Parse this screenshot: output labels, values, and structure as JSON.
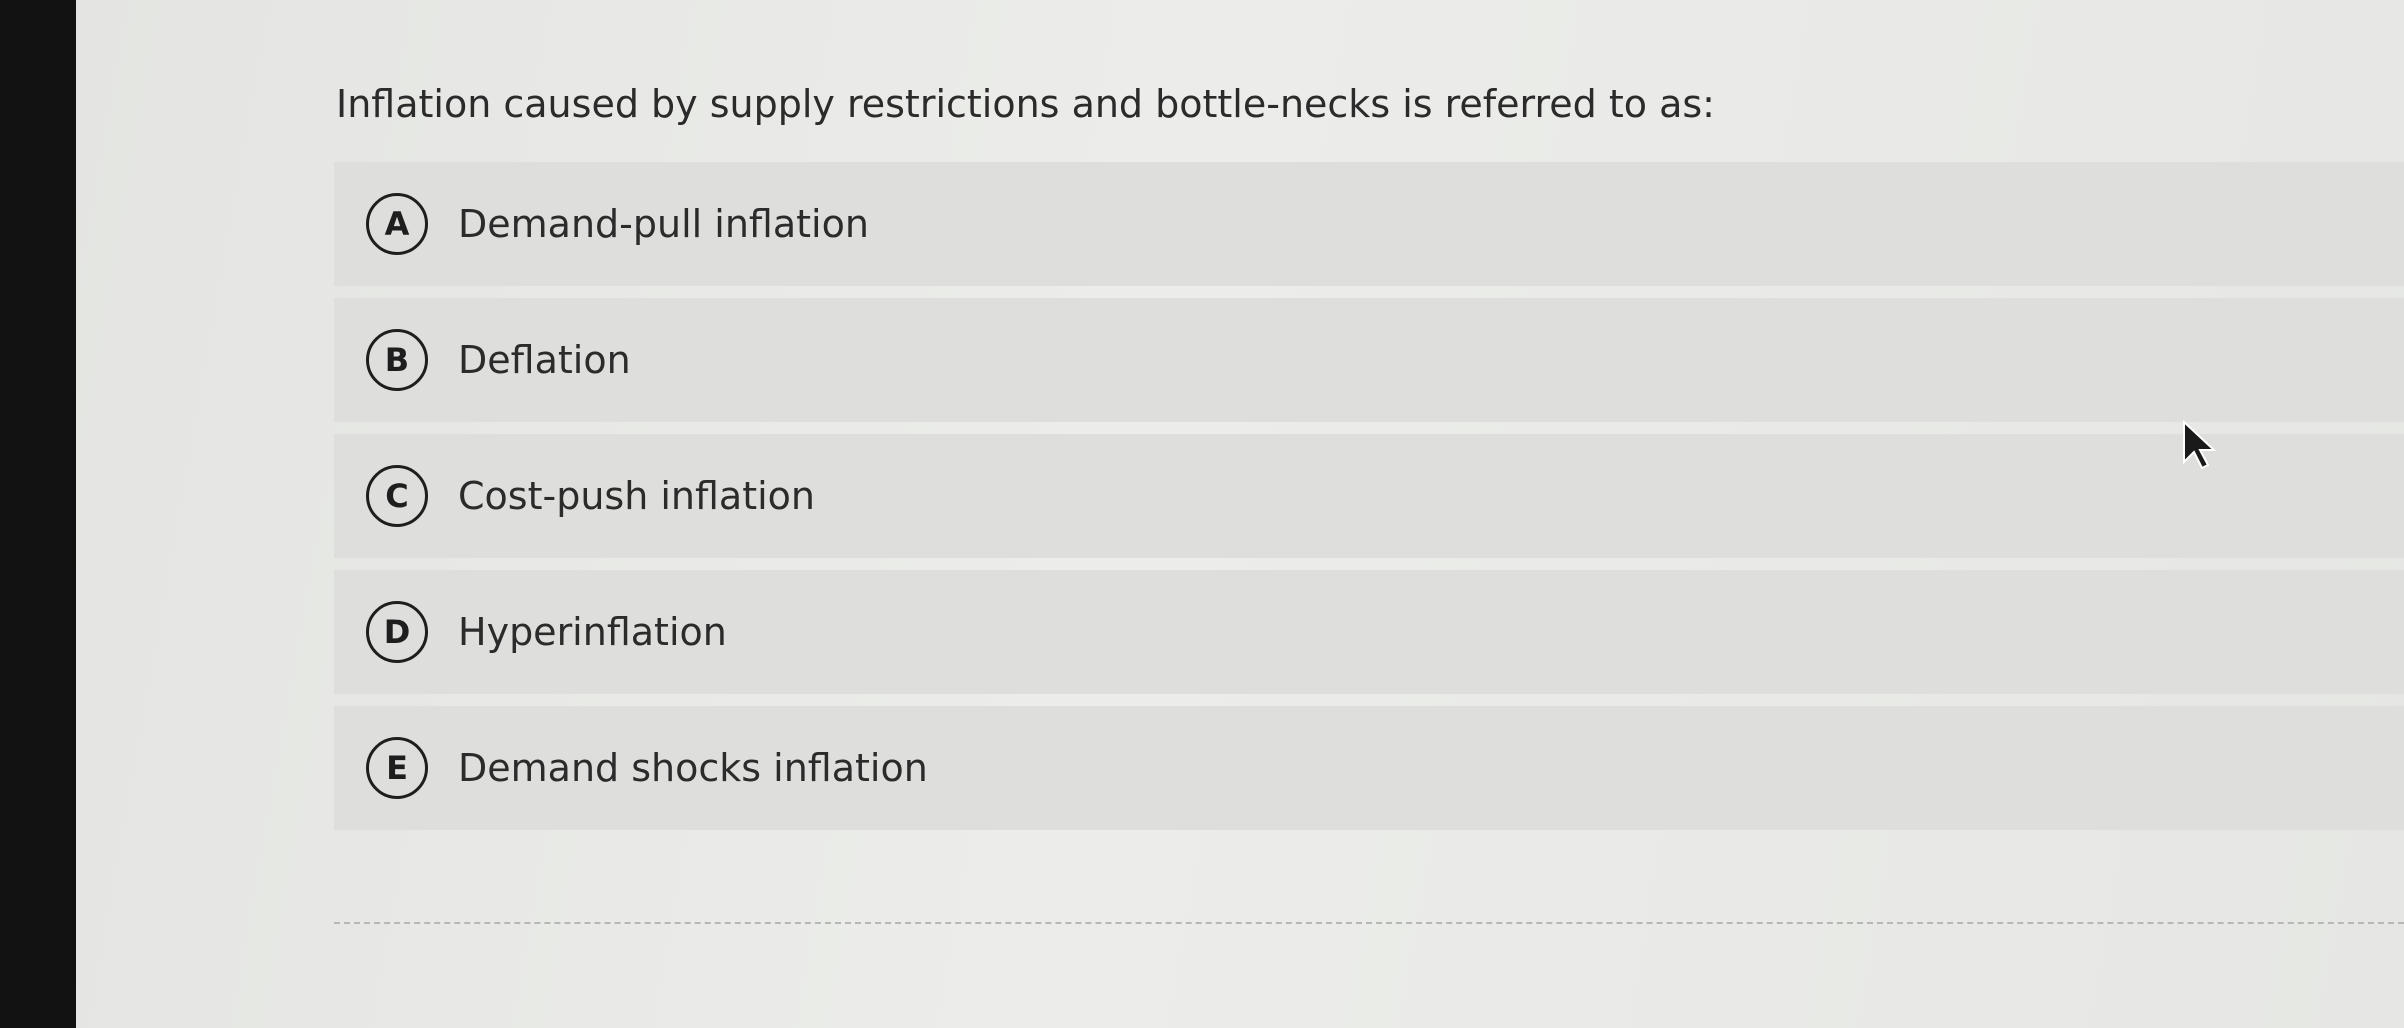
{
  "question": {
    "text": "Inflation caused by supply restrictions and bottle-necks is referred to as:"
  },
  "options": [
    {
      "letter": "A",
      "text": "Demand-pull inflation"
    },
    {
      "letter": "B",
      "text": "Deflation"
    },
    {
      "letter": "C",
      "text": "Cost-push inflation"
    },
    {
      "letter": "D",
      "text": "Hyperinflation"
    },
    {
      "letter": "E",
      "text": "Demand shocks inflation"
    }
  ],
  "icons": {
    "cursor": "mouse-pointer-icon"
  }
}
